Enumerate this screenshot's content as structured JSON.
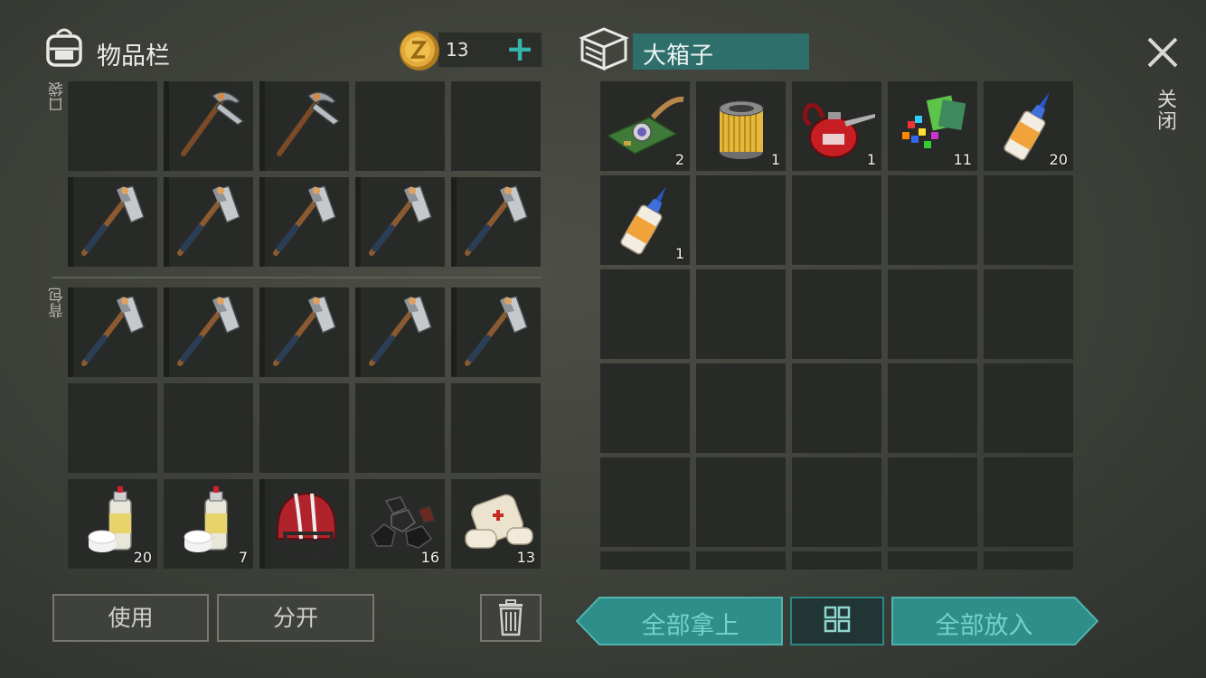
{
  "inventory": {
    "title": "物品栏",
    "coins": "13",
    "pocket_label": "口袋",
    "backpack_label": "背包",
    "pocket_slots": [
      {
        "item": "empty"
      },
      {
        "item": "pickaxe-icon",
        "durability": 0.9
      },
      {
        "item": "pickaxe-icon",
        "durability": 1.0
      },
      {
        "item": "empty"
      },
      {
        "item": "empty"
      },
      {
        "item": "hatchet-icon",
        "durability": 1.0
      },
      {
        "item": "hatchet-icon",
        "durability": 1.0
      },
      {
        "item": "hatchet-icon",
        "durability": 1.0
      },
      {
        "item": "hatchet-icon",
        "durability": 1.0
      },
      {
        "item": "hatchet-icon",
        "durability": 1.0
      }
    ],
    "backpack_slots": [
      {
        "item": "hatchet-icon",
        "durability": 1.0
      },
      {
        "item": "hatchet-icon",
        "durability": 1.0
      },
      {
        "item": "hatchet-icon",
        "durability": 1.0
      },
      {
        "item": "hatchet-icon",
        "durability": 1.0
      },
      {
        "item": "hatchet-icon",
        "durability": 1.0
      },
      {
        "item": "empty"
      },
      {
        "item": "empty"
      },
      {
        "item": "empty"
      },
      {
        "item": "empty"
      },
      {
        "item": "empty"
      },
      {
        "item": "spray-paint-icon",
        "count": "20"
      },
      {
        "item": "spray-paint-icon",
        "count": "7"
      },
      {
        "item": "helmet-icon",
        "durability": 1.0
      },
      {
        "item": "coal-icon",
        "count": "16"
      },
      {
        "item": "bandage-icon",
        "count": "13"
      }
    ]
  },
  "container": {
    "title": "大箱子",
    "slots": [
      {
        "item": "circuit-board-icon",
        "count": "2"
      },
      {
        "item": "filter-icon",
        "count": "1"
      },
      {
        "item": "oil-can-icon",
        "count": "1"
      },
      {
        "item": "plastic-scraps-icon",
        "count": "11"
      },
      {
        "item": "glue-icon",
        "count": "20"
      },
      {
        "item": "glue-icon",
        "count": "1"
      }
    ]
  },
  "close_label": "关闭",
  "buttons": {
    "use": "使用",
    "split": "分开",
    "take_all": "全部拿上",
    "put_all": "全部放入"
  },
  "colors": {
    "accent": "#2e6f6c",
    "teal_text": "#74d1ca",
    "durability": "#2b7d7b",
    "slot_bg": "#282a28"
  }
}
